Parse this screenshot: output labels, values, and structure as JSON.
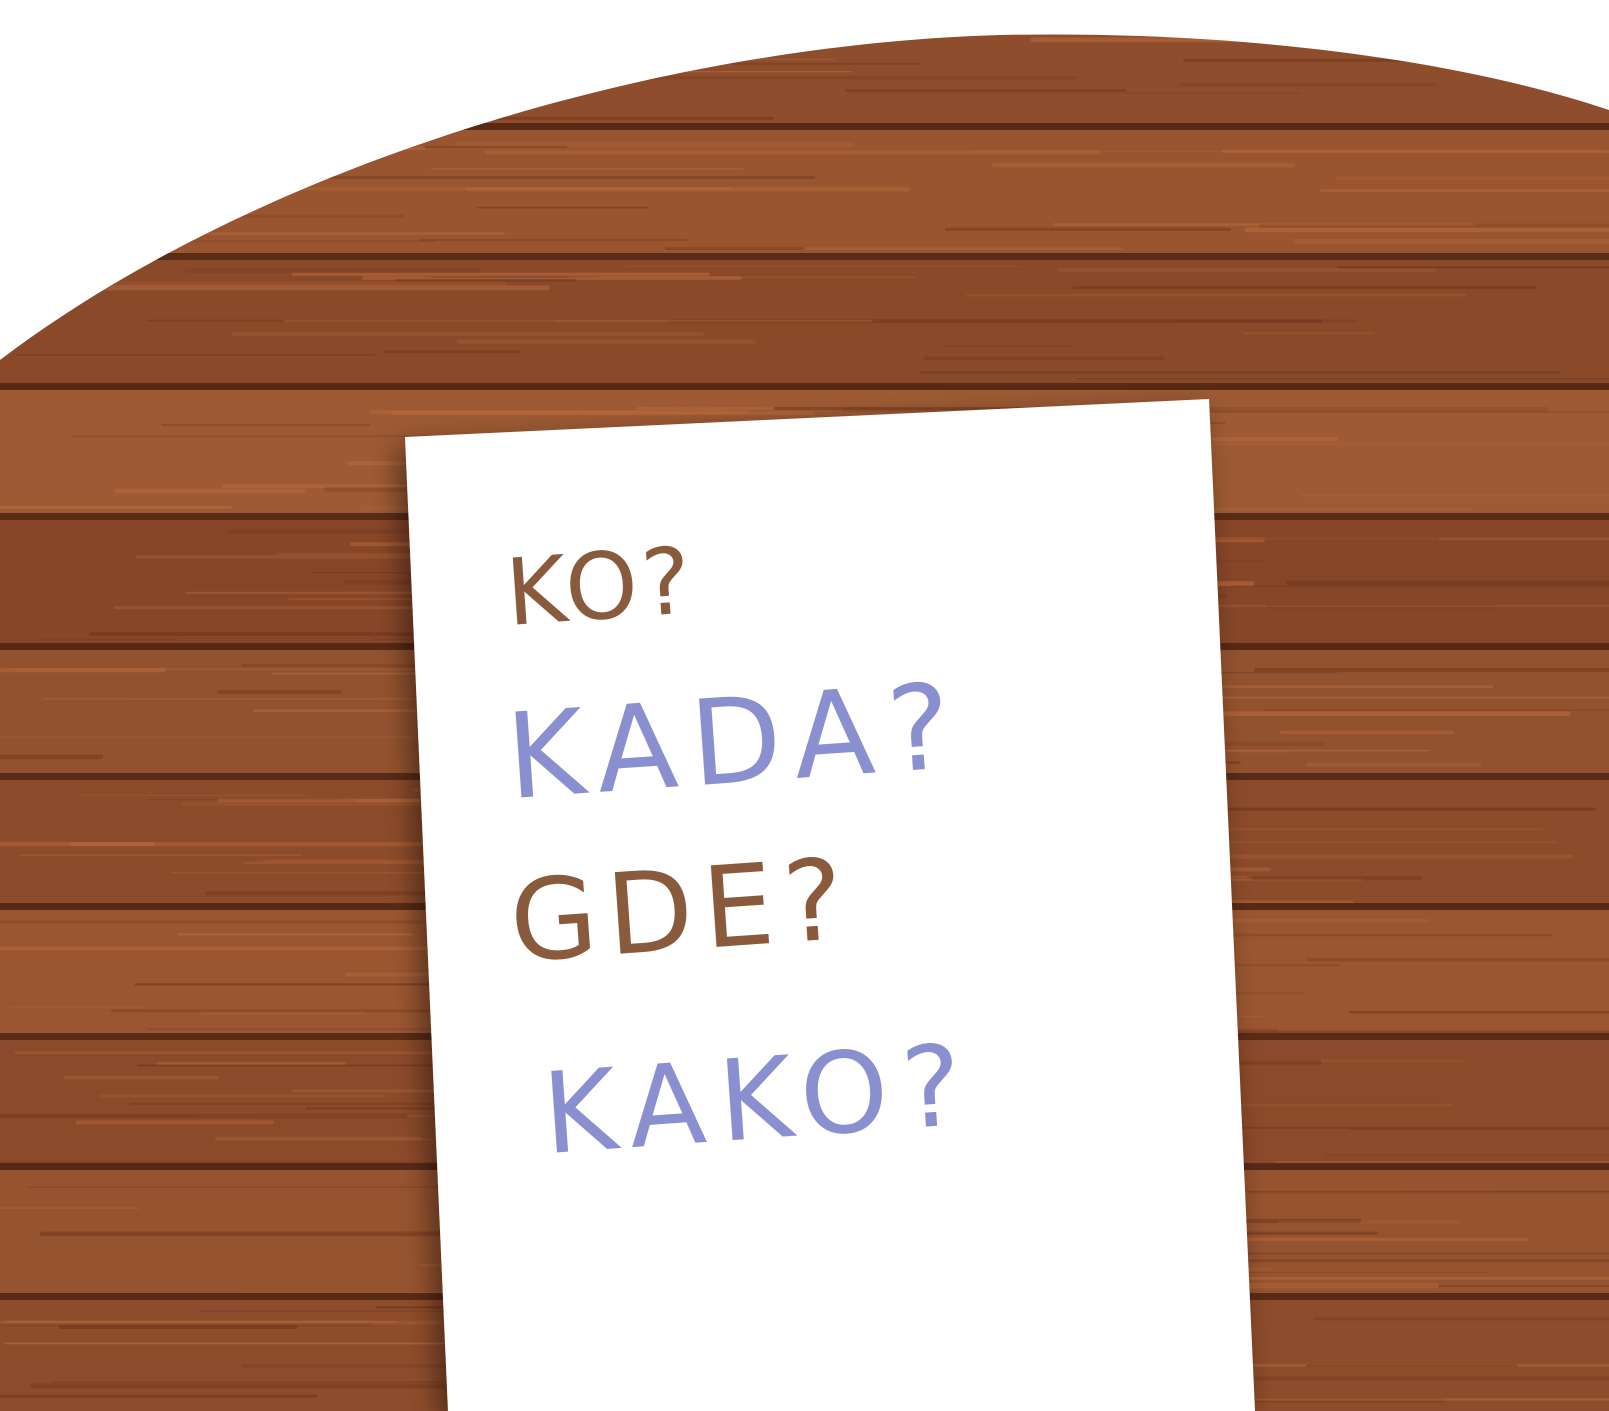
{
  "scene": {
    "description_colors": {
      "background": "#ffffff",
      "wood_base": "#8a4a2b",
      "wood_light": "#a8603a",
      "wood_dark": "#5e2d17",
      "paper": "#ffffff"
    }
  },
  "note": {
    "lines": [
      {
        "text": "KO?",
        "color": "#8a5a3c"
      },
      {
        "text": "KADA?",
        "color": "#8a8fd0"
      },
      {
        "text": "GDE?",
        "color": "#8a5a3c"
      },
      {
        "text": "KAKO?",
        "color": "#8a8fd0"
      }
    ]
  }
}
